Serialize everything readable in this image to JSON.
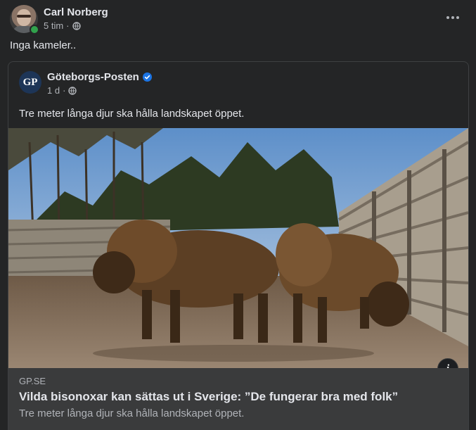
{
  "post": {
    "author": "Carl Norberg",
    "time": "5 tim",
    "separator": "·",
    "privacy_icon": "globe-icon",
    "more_icon": "more-horizontal-icon",
    "text": "Inga kameler.."
  },
  "shared": {
    "page_name": "Göteborgs-Posten",
    "logo_text": "GP",
    "verified_icon": "verified-badge-icon",
    "time": "1 d",
    "separator": "·",
    "text": "Tre meter långa djur ska hålla landskapet öppet."
  },
  "link": {
    "domain": "GP.SE",
    "title": "Vilda bisonoxar kan sättas ut i Sverige: ”De fungerar bra med folk”",
    "description": "Tre meter långa djur ska hålla landskapet öppet.",
    "info_label": "i"
  },
  "colors": {
    "background": "#242526",
    "card_footer": "#3a3b3c",
    "primary_text": "#e4e6eb",
    "secondary_text": "#b0b3b8",
    "online": "#31a24c",
    "verified": "#1b74e4"
  }
}
